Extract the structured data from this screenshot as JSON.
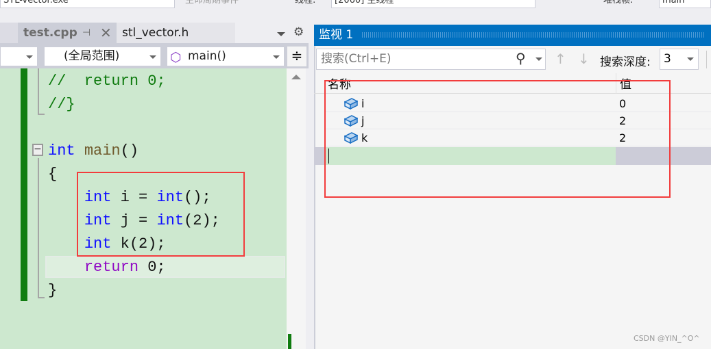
{
  "toolbar": {
    "process": "STL-vector.exe",
    "lifecycle": "生命周期事件",
    "thread_label": "线程:",
    "thread": "[2060] 主线程",
    "stack_label": "堆栈帧:",
    "stack": "main"
  },
  "editor": {
    "tabs": [
      {
        "label": "test.cpp",
        "active": true
      },
      {
        "label": "stl_vector.h",
        "active": false
      }
    ],
    "scope": "(全局范围)",
    "function": "main()",
    "lines": [
      [
        [
          "cm",
          "//  return 0;"
        ]
      ],
      [
        [
          "cm",
          "//}"
        ]
      ],
      [],
      [
        [
          "kw",
          "int"
        ],
        [
          "tx",
          " "
        ],
        [
          "fn",
          "main"
        ],
        [
          "tx",
          "()"
        ]
      ],
      [
        [
          "tx",
          "{"
        ]
      ],
      [
        [
          "tx",
          "    "
        ],
        [
          "kw",
          "int"
        ],
        [
          "tx",
          " i = "
        ],
        [
          "kw",
          "int"
        ],
        [
          "tx",
          "();"
        ]
      ],
      [
        [
          "tx",
          "    "
        ],
        [
          "kw",
          "int"
        ],
        [
          "tx",
          " j = "
        ],
        [
          "kw",
          "int"
        ],
        [
          "tx",
          "(2);"
        ]
      ],
      [
        [
          "tx",
          "    "
        ],
        [
          "kw",
          "int"
        ],
        [
          "tx",
          " k(2);"
        ]
      ],
      [
        [
          "tx",
          "    "
        ],
        [
          "pp",
          "return"
        ],
        [
          "tx",
          " 0;"
        ]
      ],
      [
        [
          "tx",
          "}"
        ]
      ]
    ]
  },
  "watch": {
    "title": "监视 1",
    "search_placeholder": "搜索(Ctrl+E)",
    "depth_label": "搜索深度:",
    "depth": "3",
    "columns": [
      "名称",
      "值"
    ],
    "rows": [
      {
        "name": "i",
        "value": "0"
      },
      {
        "name": "j",
        "value": "2"
      },
      {
        "name": "k",
        "value": "2"
      }
    ]
  },
  "colors": {
    "accent": "#0070c0",
    "highlight": "#f23c3c",
    "code_bg": "#cde8cf"
  },
  "watermark": "CSDN @YIN_^O^"
}
